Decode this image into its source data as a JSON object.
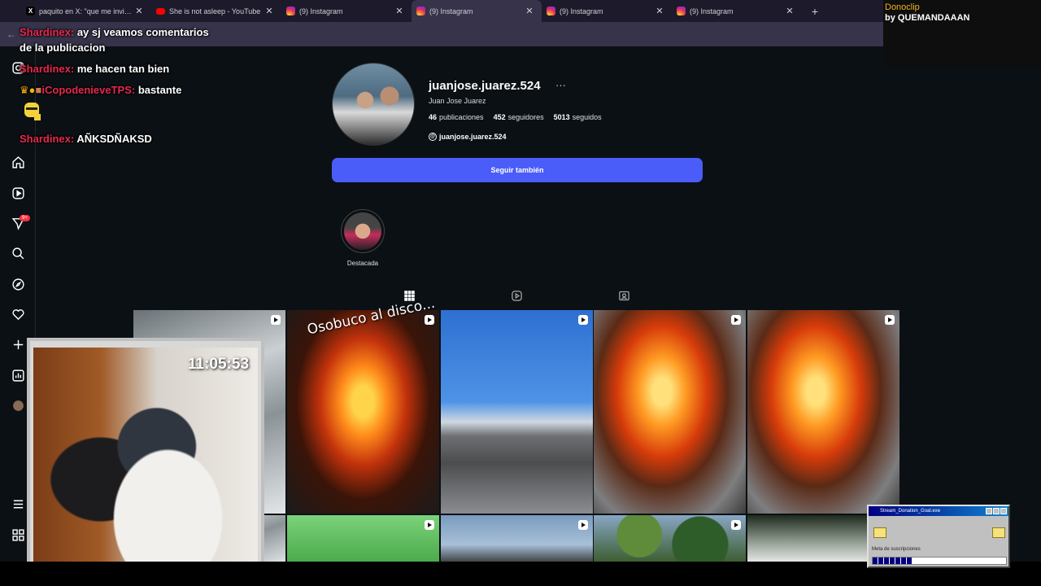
{
  "browser": {
    "tabs": [
      {
        "title": "paquito en X: \"que me invita a c",
        "icon": "x-icon",
        "active": false
      },
      {
        "title": "She is not asleep - YouTube",
        "icon": "youtube-icon",
        "active": false
      },
      {
        "title": "(9) Instagram",
        "icon": "instagram-icon",
        "active": false
      },
      {
        "title": "(9) Instagram",
        "icon": "instagram-icon",
        "active": true
      },
      {
        "title": "(9) Instagram",
        "icon": "instagram-icon",
        "active": false
      },
      {
        "title": "(9) Instagram",
        "icon": "instagram-icon",
        "active": false
      }
    ],
    "new_tab": "+"
  },
  "profile": {
    "username": "juanjose.juarez.524",
    "more": "···",
    "full_name": "Juan Jose Juarez",
    "posts_count": "46",
    "posts_label": "publicaciones",
    "followers_count": "452",
    "followers_label": "seguidores",
    "following_count": "5013",
    "following_label": "seguidos",
    "threads_handle": "juanjose.juarez.524",
    "follow_button": "Seguir también",
    "highlight_label": "Destacada"
  },
  "sidebar": {
    "notifications_badge": "9+"
  },
  "grid": {
    "caption_text": "Osobuco al disco..."
  },
  "chat": {
    "messages": [
      {
        "user": "Shardinex:",
        "text": "ay sj veamos comentarios"
      },
      {
        "user": "",
        "text": "de la publicacion"
      },
      {
        "user": "Shardinex:",
        "text": "me hacen tan bien"
      },
      {
        "user": "iCopodenieveTPS:",
        "text": "bastante"
      },
      {
        "user": "Shardinex:",
        "text": "AÑKSDÑAKSD"
      }
    ]
  },
  "overlay": {
    "donoclip_title": "Donoclip",
    "donoclip_by": "by QUEMANDAAAN",
    "clock": "11:05:53",
    "goal_window_title": "Stream_Donation_Goal.exe",
    "goal_label": "Meta de suscripciones",
    "goal_progress": 0.3
  },
  "colors": {
    "follow_button": "#4a5df9",
    "chat_username": "#e8274d",
    "page_bg": "#0b1014"
  }
}
